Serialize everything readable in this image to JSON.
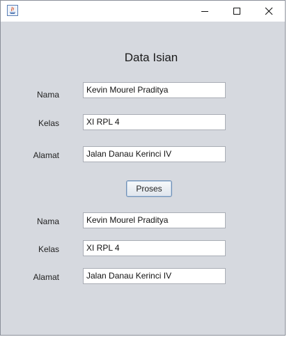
{
  "window": {
    "controls": {
      "minimize_icon": "minimize-icon",
      "maximize_icon": "maximize-icon",
      "close_icon": "close-icon"
    }
  },
  "form": {
    "heading": "Data Isian",
    "input": {
      "nama_label": "Nama",
      "nama_value": "Kevin Mourel Praditya",
      "kelas_label": "Kelas",
      "kelas_value": "XI RPL 4",
      "alamat_label": "Alamat",
      "alamat_value": "Jalan Danau Kerinci IV"
    },
    "process_button": "Proses",
    "output": {
      "nama_label": "Nama",
      "nama_value": "Kevin Mourel Praditya",
      "kelas_label": "Kelas",
      "kelas_value": "XI RPL 4",
      "alamat_label": "Alamat",
      "alamat_value": "Jalan Danau Kerinci IV"
    }
  }
}
